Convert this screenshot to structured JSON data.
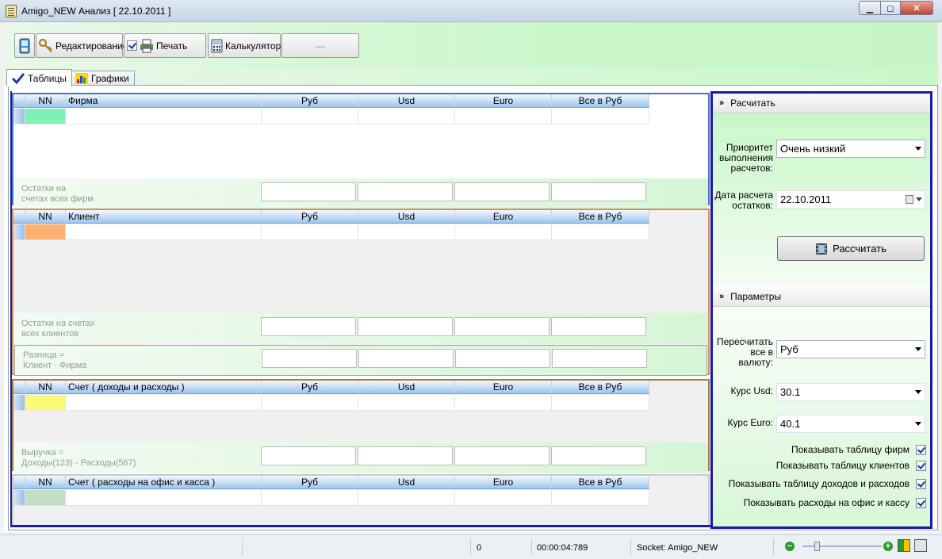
{
  "window": {
    "title": "Amigo_NEW Анализ [ 22.10.2011 ]"
  },
  "toolbar": {
    "edit_label": "Редактирование",
    "print_label": "Печать",
    "calc_label": "Калькулятор",
    "extra_label": "—"
  },
  "tabs": [
    {
      "label": "Таблицы"
    },
    {
      "label": "Графики"
    }
  ],
  "grid_columns": {
    "nn": "NN",
    "rub": "Руб",
    "usd": "Usd",
    "euro": "Euro",
    "all_rub": "Все в Руб"
  },
  "grids": {
    "firms": {
      "name_col": "Фирма",
      "summary_label": "Остатки на\nсчетах всех фирм",
      "accent": "#7ef2b4"
    },
    "clients": {
      "name_col": "Клиент",
      "summary_label": "Остатки на счетах\nвсех клиентов",
      "diff_label": "Разница =\nКлиент - Фирма",
      "accent": "#ffb070"
    },
    "income": {
      "name_col": "Счет ( доходы и расходы )",
      "summary_label": "Выручка =\nДоходы(123)  -  Расходы(567)",
      "accent": "#fafa78"
    },
    "office": {
      "name_col": "Счет ( расходы на офис и касса )",
      "accent": "#c4e0c4"
    }
  },
  "panel": {
    "calc_section": "Расчитать",
    "priority_label": "Приоритет\nвыполнения\nрасчетов:",
    "priority_value": "Очень низкий",
    "date_label": "Дата расчета\nостатков:",
    "date_value": "22.10.2011",
    "calc_button": "Рассчитать",
    "params_section": "Параметры",
    "currency_label": "Пересчитать\nвсе в\nвалюту:",
    "currency_value": "Руб",
    "usd_label": "Курс Usd:",
    "usd_value": "30.1",
    "euro_label": "Курс Euro:",
    "euro_value": "40.1",
    "checks": [
      {
        "label": "Показывать таблицу фирм",
        "checked": true
      },
      {
        "label": "Показывать таблицу клиентов",
        "checked": true
      },
      {
        "label": "Показывать таблицу доходов и расходов",
        "checked": true
      },
      {
        "label": "Показывать расходы на офис и кассу",
        "checked": true
      }
    ]
  },
  "status": {
    "count": "0",
    "elapsed": "00:00:04:789",
    "socket": "Socket: Amigo_NEW"
  },
  "colors": {
    "firms_border": "#4a72c8",
    "clients_border": "#d4905a",
    "income_border": "#a08040",
    "panel_border": "#1a1aa8"
  }
}
